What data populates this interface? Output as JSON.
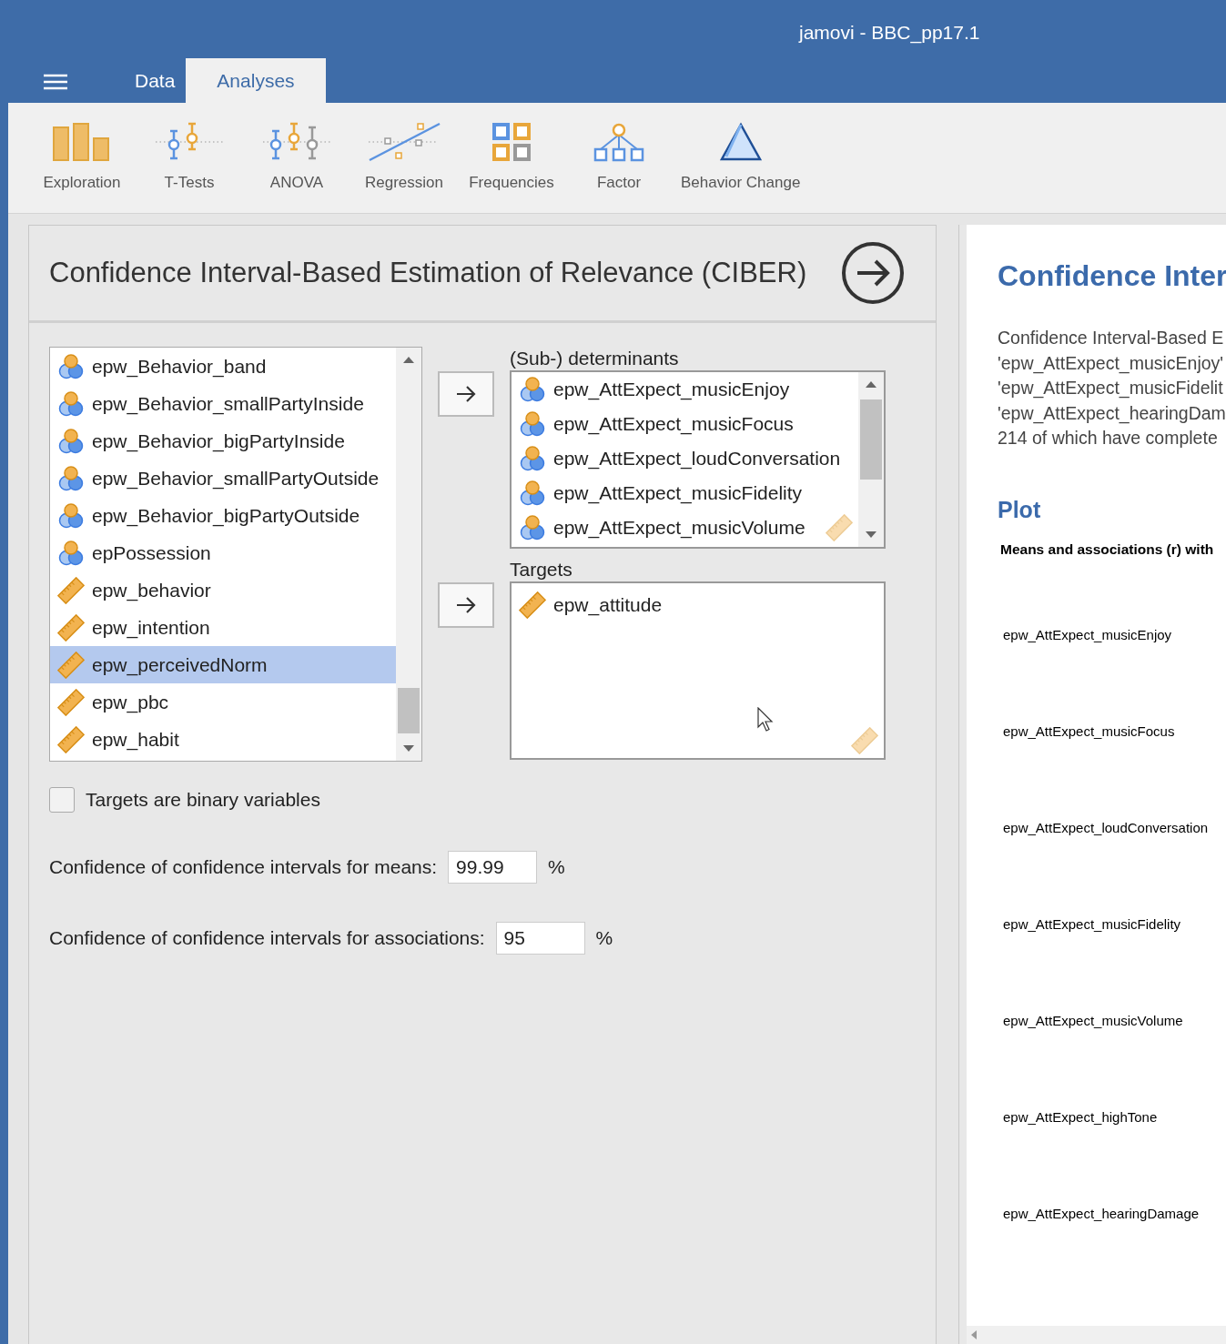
{
  "window": {
    "title": "jamovi - BBC_pp17.1"
  },
  "tabs": [
    {
      "label": "Data",
      "selected": false
    },
    {
      "label": "Analyses",
      "selected": true
    }
  ],
  "toolbar": [
    {
      "label": "Exploration",
      "kind": "exploration"
    },
    {
      "label": "T-Tests",
      "kind": "ttests"
    },
    {
      "label": "ANOVA",
      "kind": "anova"
    },
    {
      "label": "Regression",
      "kind": "regression"
    },
    {
      "label": "Frequencies",
      "kind": "frequencies"
    },
    {
      "label": "Factor",
      "kind": "factor"
    },
    {
      "label": "Behavior Change",
      "kind": "behavior"
    }
  ],
  "analysis": {
    "title": "Confidence Interval-Based Estimation of Relevance (CIBER)",
    "variables": [
      {
        "name": "epw_Behavior_band",
        "kind": "nominal",
        "selected": false
      },
      {
        "name": "epw_Behavior_smallPartyInside",
        "kind": "nominal",
        "selected": false
      },
      {
        "name": "epw_Behavior_bigPartyInside",
        "kind": "nominal",
        "selected": false
      },
      {
        "name": "epw_Behavior_smallPartyOutside",
        "kind": "nominal",
        "selected": false
      },
      {
        "name": "epw_Behavior_bigPartyOutside",
        "kind": "nominal",
        "selected": false
      },
      {
        "name": "epPossession",
        "kind": "nominal",
        "selected": false
      },
      {
        "name": "epw_behavior",
        "kind": "continuous",
        "selected": false
      },
      {
        "name": "epw_intention",
        "kind": "continuous",
        "selected": false
      },
      {
        "name": "epw_perceivedNorm",
        "kind": "continuous",
        "selected": true
      },
      {
        "name": "epw_pbc",
        "kind": "continuous",
        "selected": false
      },
      {
        "name": "epw_habit",
        "kind": "continuous",
        "selected": false
      }
    ],
    "determinants": {
      "label": "(Sub-) determinants",
      "items": [
        {
          "name": "epw_AttExpect_musicEnjoy",
          "kind": "nominal"
        },
        {
          "name": "epw_AttExpect_musicFocus",
          "kind": "nominal"
        },
        {
          "name": "epw_AttExpect_loudConversation",
          "kind": "nominal"
        },
        {
          "name": "epw_AttExpect_musicFidelity",
          "kind": "nominal"
        },
        {
          "name": "epw_AttExpect_musicVolume",
          "kind": "nominal"
        }
      ]
    },
    "targets": {
      "label": "Targets",
      "items": [
        {
          "name": "epw_attitude",
          "kind": "continuous"
        }
      ]
    },
    "binary_option": {
      "label": "Targets are binary variables",
      "checked": false
    },
    "means_ci": {
      "label": "Confidence of confidence intervals for means:",
      "value": "99.99",
      "unit": "%"
    },
    "assoc_ci": {
      "label": "Confidence of confidence intervals for associations:",
      "value": "95",
      "unit": "%"
    }
  },
  "results": {
    "title": "Confidence Inter",
    "description": [
      "Confidence Interval-Based E",
      "'epw_AttExpect_musicEnjoy'",
      "'epw_AttExpect_musicFidelit",
      "'epw_AttExpect_hearingDam",
      "214 of which have complete"
    ],
    "plot_heading": "Plot",
    "plot_title": "Means and associations (r) with",
    "plot_labels": [
      "epw_AttExpect_musicEnjoy",
      "epw_AttExpect_musicFocus",
      "epw_AttExpect_loudConversation",
      "epw_AttExpect_musicFidelity",
      "epw_AttExpect_musicVolume",
      "epw_AttExpect_highTone",
      "epw_AttExpect_hearingDamage"
    ]
  }
}
